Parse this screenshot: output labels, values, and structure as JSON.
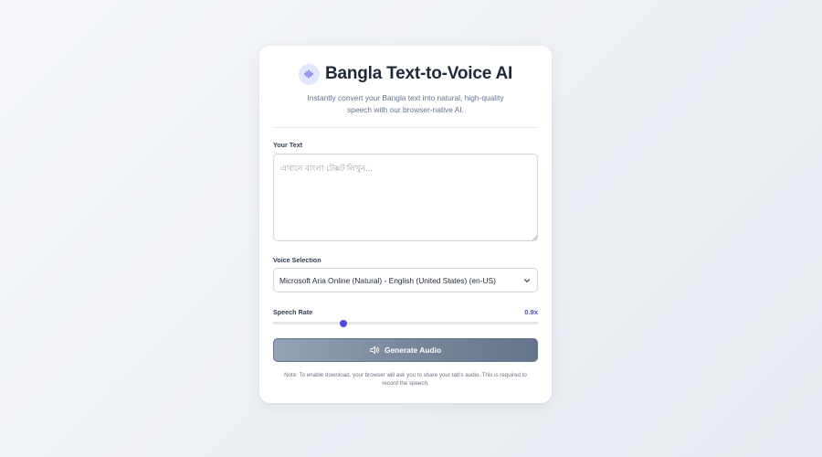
{
  "app": {
    "title": "Bangla Text-to-Voice AI",
    "subtitle": "Instantly convert your Bangla text into natural, high-quality speech with our browser-native AI."
  },
  "text_input": {
    "label": "Your Text",
    "placeholder": "এখানে বাংলা টেক্সট লিখুন...",
    "value": ""
  },
  "voice": {
    "label": "Voice Selection",
    "selected": "Microsoft Aria Online (Natural) - English (United States) (en-US)"
  },
  "rate": {
    "label": "Speech Rate",
    "value_text": "0.9x",
    "value": 0.9,
    "min": 0.5,
    "max": 2.0
  },
  "generate_button": {
    "label": "Generate Audio",
    "icon": "speaker-icon"
  },
  "note": "Note: To enable download, your browser will ask you to share your tab's audio. This is required to record the speech.",
  "colors": {
    "accent": "#4f46e5",
    "logo_bg": "#e0e7ff",
    "button_start": "#94a3b8",
    "button_end": "#64748b"
  }
}
